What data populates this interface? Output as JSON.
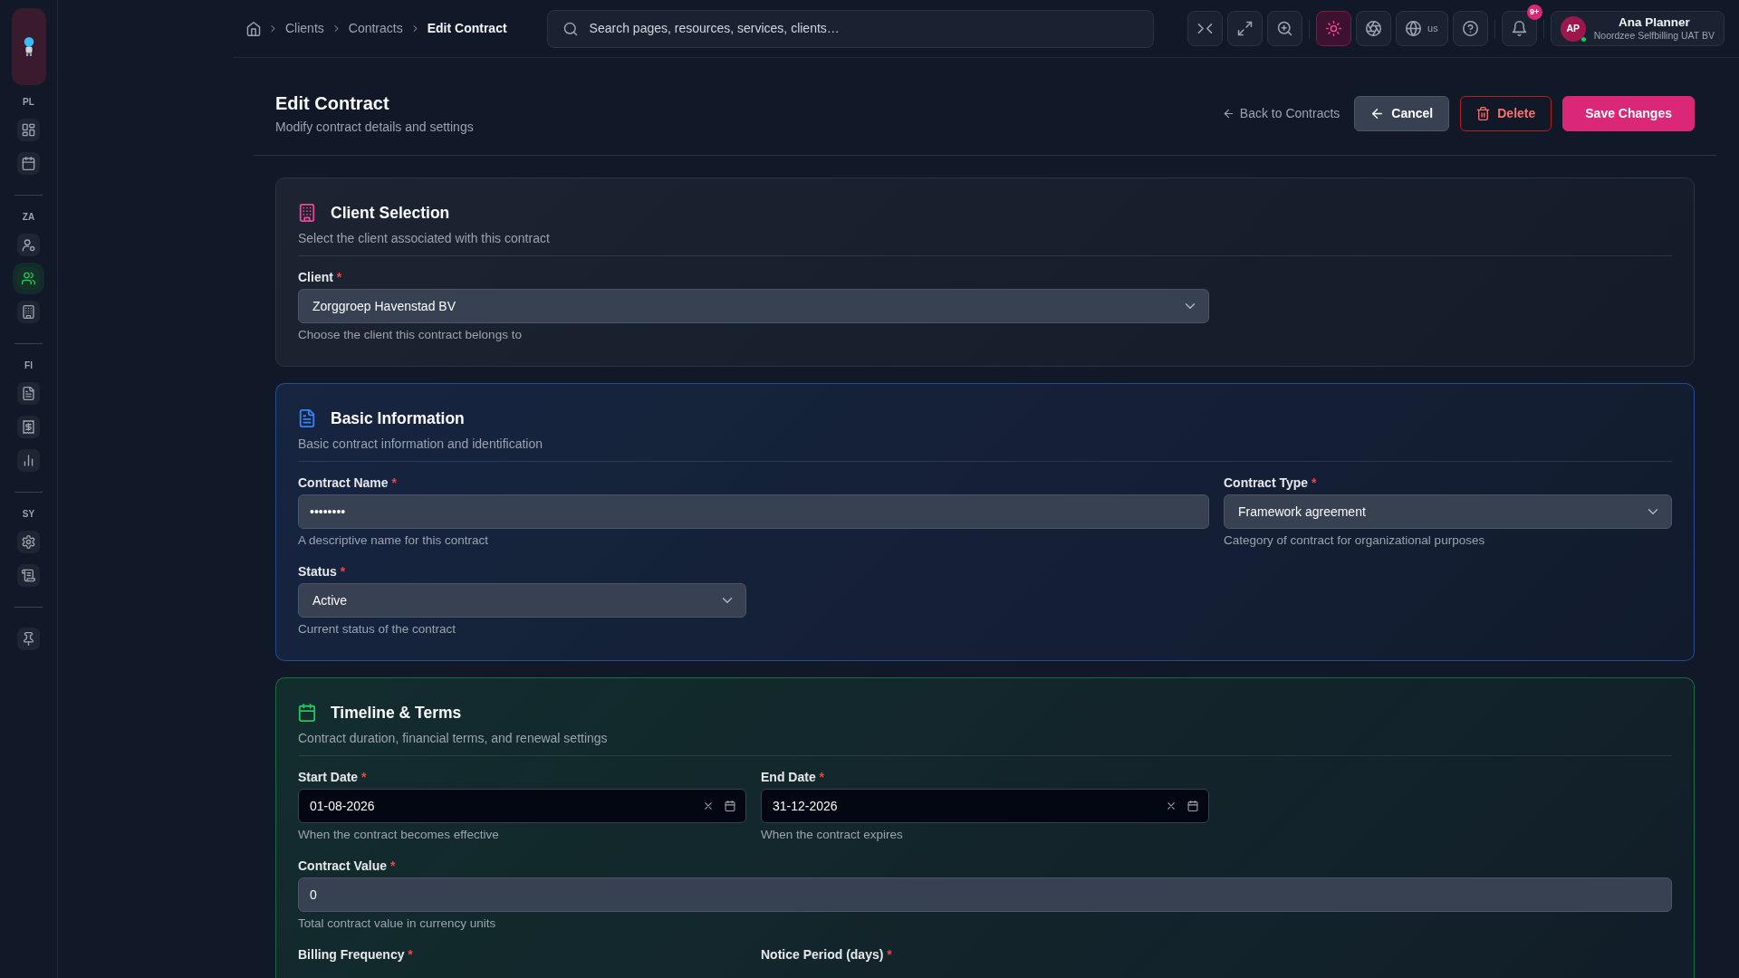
{
  "sidebar": {
    "groups": [
      {
        "label": "PL",
        "items": [
          {
            "kind": "dashboard",
            "selected": false
          },
          {
            "kind": "calendar",
            "selected": false
          }
        ]
      },
      {
        "label": "ZA",
        "items": [
          {
            "kind": "user-settings",
            "selected": false
          },
          {
            "kind": "users",
            "selected": true
          },
          {
            "kind": "building",
            "selected": false
          }
        ]
      },
      {
        "label": "FI",
        "items": [
          {
            "kind": "document",
            "selected": false
          },
          {
            "kind": "receipt",
            "selected": false
          },
          {
            "kind": "chart",
            "selected": false
          }
        ]
      },
      {
        "label": "SY",
        "items": [
          {
            "kind": "settings",
            "selected": false
          },
          {
            "kind": "scroll",
            "selected": false
          }
        ]
      }
    ]
  },
  "topbar": {
    "breadcrumb": [
      {
        "label": "Clients",
        "current": false
      },
      {
        "label": "Contracts",
        "current": false
      },
      {
        "label": "Edit Contract",
        "current": true
      }
    ],
    "search": {
      "placeholder": "Search pages, resources, services, clients…"
    },
    "tools": [
      {
        "kind": "collapse",
        "active": false
      },
      {
        "kind": "fullscreen",
        "active": false
      },
      {
        "kind": "zoom",
        "active": false
      },
      {
        "kind": "theme",
        "active": true
      },
      {
        "kind": "aperture",
        "active": false
      },
      {
        "kind": "language",
        "active": false,
        "label": "us"
      },
      {
        "kind": "help",
        "active": false
      },
      {
        "kind": "notifications",
        "active": false,
        "badge": "9+"
      }
    ],
    "user": {
      "initials": "AP",
      "name": "Ana Planner",
      "organization": "Noordzee Selfbilling UAT BV",
      "online": true
    }
  },
  "header": {
    "title": "Edit Contract",
    "subtitle": "Modify contract details and settings",
    "back_link": "Back to Contracts",
    "actions": [
      {
        "kind": "cancel",
        "label": "Cancel"
      },
      {
        "kind": "delete",
        "label": "Delete"
      },
      {
        "kind": "save",
        "label": "Save Changes"
      }
    ]
  },
  "sections": [
    {
      "kind": "client",
      "color": "#ec4899",
      "highlighted": false,
      "title": "Client Selection",
      "description": "Select the client associated with this contract",
      "fields": [
        {
          "kind": "select",
          "label": "Client",
          "required_mark": "*",
          "value": "Zorggroep Havenstad BV",
          "help": "Choose the client this contract belongs to"
        }
      ]
    },
    {
      "kind": "details",
      "color": "#3b82f6",
      "highlighted": true,
      "title": "Basic Information",
      "description": "Basic contract information and identification",
      "fields": [
        {
          "kind": "text",
          "label": "Contract Name",
          "required_mark": "*",
          "value": "••••••••",
          "help": "A descriptive name for this contract"
        },
        {
          "kind": "select",
          "label": "Contract Type",
          "required_mark": "*",
          "value": "Framework agreement",
          "help": "Category of contract for organizational purposes"
        },
        {
          "kind": "select",
          "label": "Status",
          "required_mark": "*",
          "value": "Active",
          "help": "Current status of the contract"
        }
      ]
    },
    {
      "kind": "timeline",
      "color": "#22c55e",
      "highlighted": true,
      "title": "Timeline & Terms",
      "description": "Contract duration, financial terms, and renewal settings",
      "fields": [
        {
          "kind": "date",
          "label": "Start Date",
          "required_mark": "*",
          "value": "01-08-2026",
          "help": "When the contract becomes effective"
        },
        {
          "kind": "date",
          "label": "End Date",
          "required_mark": "*",
          "value": "31-12-2026",
          "help": "When the contract expires"
        },
        {
          "kind": "number",
          "label": "Contract Value",
          "required_mark": "*",
          "value": "0",
          "help": "Total contract value in currency units"
        },
        {
          "label": "Billing Frequency",
          "required_mark": "*"
        },
        {
          "label": "Notice Period (days)",
          "required_mark": "*"
        }
      ]
    }
  ]
}
